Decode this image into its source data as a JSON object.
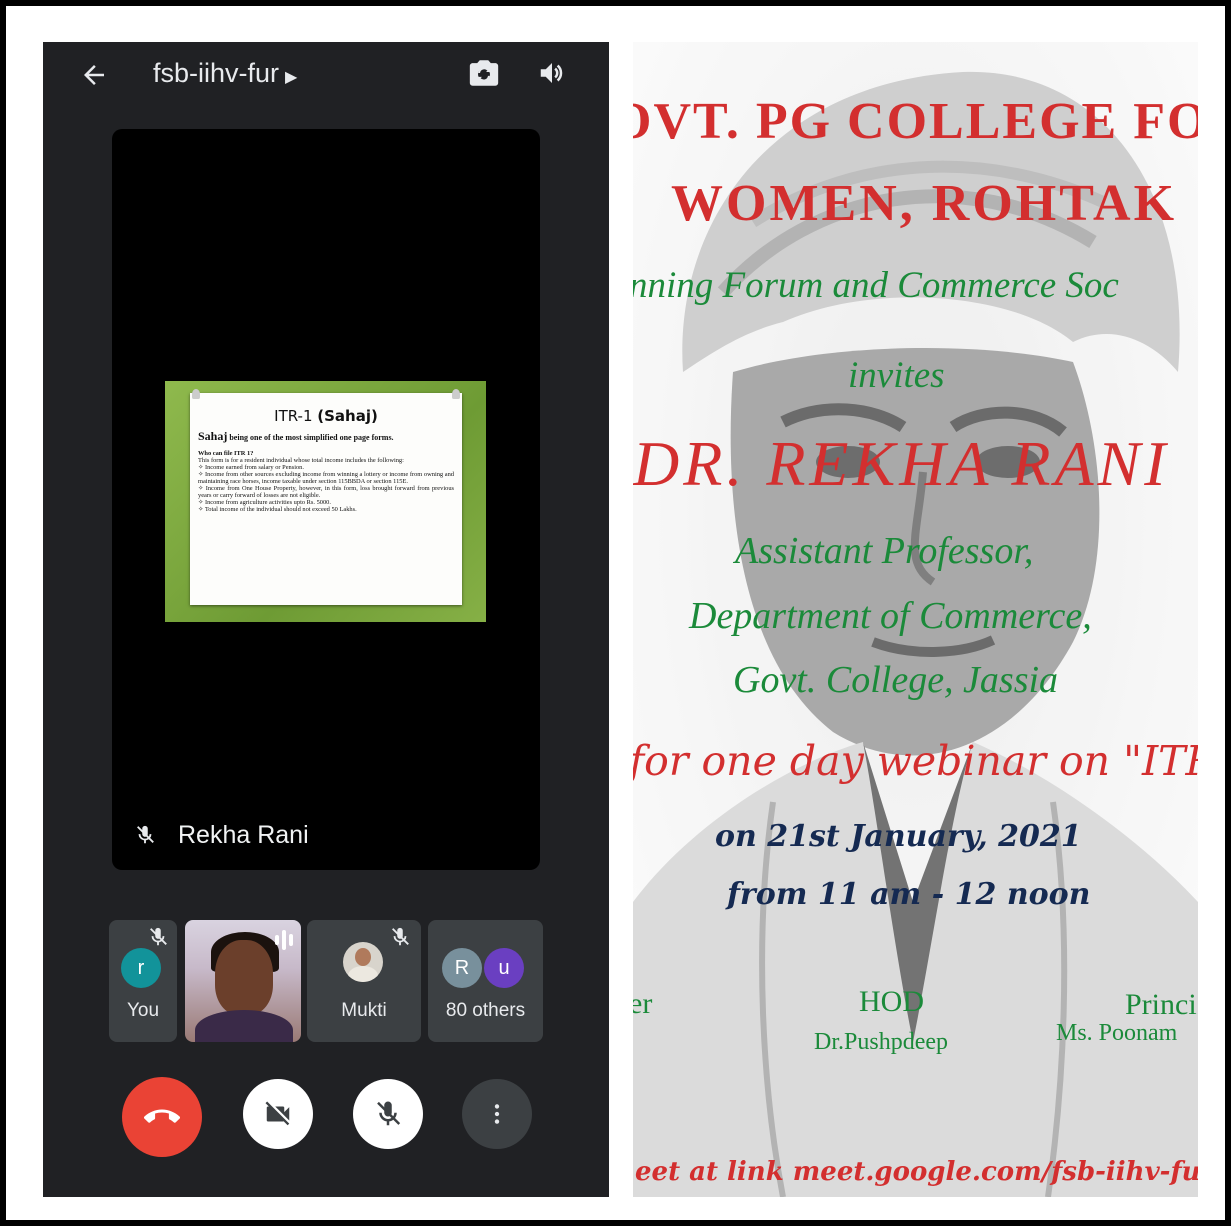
{
  "meet": {
    "meeting_code": "fsb-iihv-fur",
    "presenter_name": "Rekha Rani",
    "slide": {
      "title_plain": "ITR-1 ",
      "title_bold": "(Sahaj)",
      "subtitle_bold": "Sahaj",
      "subtitle_rest": " being one of the most simplified one page forms.",
      "question": "Who can file ITR 1?",
      "intro": "This form is for a resident individual whose total income includes the following:",
      "items": [
        "Income earned from salary or Pension.",
        "Income from other sources excluding income from winning a lottery or income from owning and maintaining race horses, income taxable under section 115BBDA or section 115E.",
        "Income from One House Property, however, in this form, loss brought forward from previous years or carry forward of losses are not eligible.",
        "Income from agriculture activities upto Rs. 5000.",
        "Total income of the individual should not exceed 50 Lakhs."
      ]
    },
    "participants": [
      {
        "label": "You",
        "avatar_letter": "r",
        "avatar_color": "#12939a",
        "muted": true
      },
      {
        "label": "",
        "video": true,
        "speaking": true
      },
      {
        "label": "Mukti",
        "muted": true
      },
      {
        "label": "80 others",
        "avatar_letters": [
          "R",
          "u"
        ],
        "avatar_colors": [
          "#78909c",
          "#6a3fc1"
        ]
      }
    ],
    "controls": {
      "end_call_color": "#ea4335"
    }
  },
  "poster": {
    "line1": "OVT. PG COLLEGE FO",
    "line2": "WOMEN, ROHTAK",
    "line3": "nning Forum and Commerce Soc",
    "line4": "invites",
    "line5": "DR. REKHA RANI",
    "line6": "Assistant Professor,",
    "line7": "Department of Commerce,",
    "line8": "Govt. College, Jassia",
    "line9": "for one day webinar on \"ITR",
    "line10": "on 21st January, 2021",
    "line11": "from 11 am - 12 noon",
    "left_role": "er",
    "left_name": "",
    "hod_title": "HOD",
    "hod_name": "Dr.Pushpdeep",
    "principal_title": "Princi",
    "principal_name": "Ms. Poonam",
    "footer": "eet at link meet.google.com/fsb-iihv-fu"
  }
}
